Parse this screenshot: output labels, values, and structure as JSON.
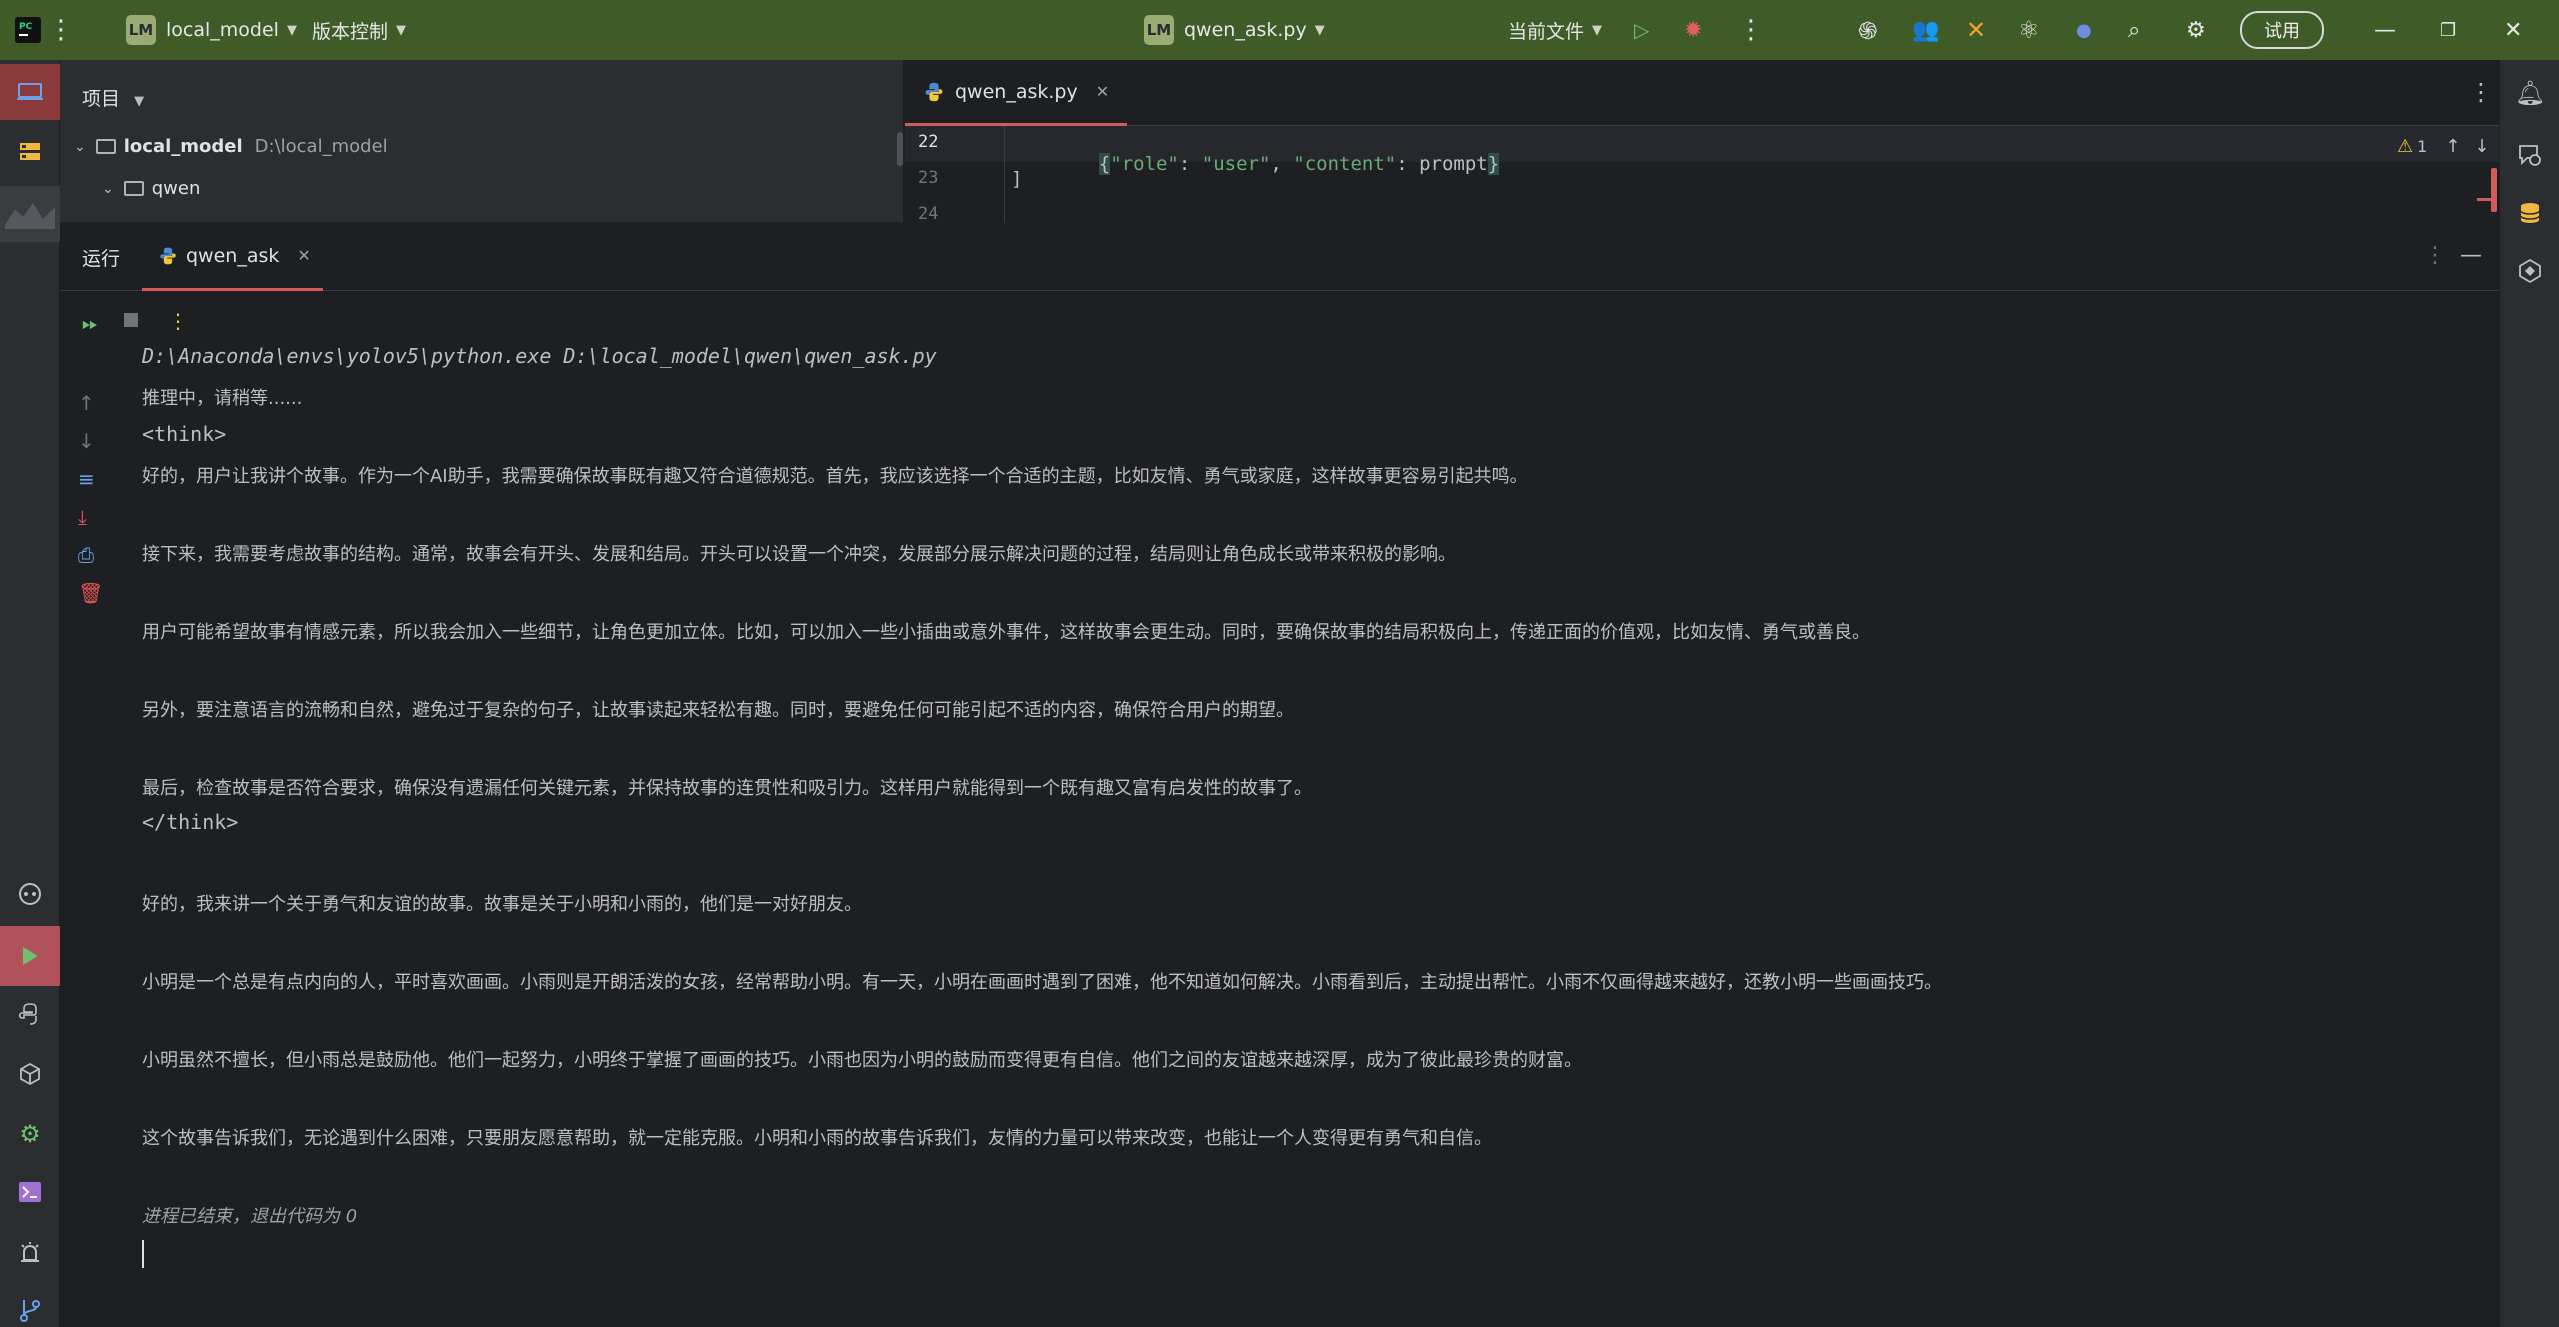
{
  "titlebar": {
    "project_badge": "LM",
    "project_name": "local_model",
    "vcs": "版本控制",
    "file_badge": "LM",
    "file_name": "qwen_ask.py",
    "run_config": "当前文件",
    "trial": "试用"
  },
  "project_panel": {
    "header": "项目",
    "root_name": "local_model",
    "root_path": "D:\\local_model",
    "child": "qwen"
  },
  "editor": {
    "tab_name": "qwen_ask.py",
    "warning_count": "1",
    "lines": [
      {
        "num": "22",
        "indent": "    ",
        "code": "{\"role\": \"user\", \"content\": prompt}"
      },
      {
        "num": "23",
        "indent": "",
        "code": "]"
      },
      {
        "num": "24",
        "indent": "",
        "code": ""
      }
    ]
  },
  "run_panel": {
    "label": "运行",
    "tab_name": "qwen_ask",
    "console": [
      {
        "text": "D:\\Anaconda\\envs\\yolov5\\python.exe D:\\local_model\\qwen\\qwen_ask.py",
        "style": "mono-italic"
      },
      {
        "text": "推理中，请稍等......",
        "style": "normal"
      },
      {
        "text": "<think>",
        "style": "mono"
      },
      {
        "text": "好的，用户让我讲个故事。作为一个AI助手，我需要确保故事既有趣又符合道德规范。首先，我应该选择一个合适的主题，比如友情、勇气或家庭，这样故事更容易引起共鸣。",
        "style": "normal"
      },
      {
        "text": "",
        "style": "normal"
      },
      {
        "text": "接下来，我需要考虑故事的结构。通常，故事会有开头、发展和结局。开头可以设置一个冲突，发展部分展示解决问题的过程，结局则让角色成长或带来积极的影响。",
        "style": "normal"
      },
      {
        "text": "",
        "style": "normal"
      },
      {
        "text": "用户可能希望故事有情感元素，所以我会加入一些细节，让角色更加立体。比如，可以加入一些小插曲或意外事件，这样故事会更生动。同时，要确保故事的结局积极向上，传递正面的价值观，比如友情、勇气或善良。",
        "style": "normal"
      },
      {
        "text": "",
        "style": "normal"
      },
      {
        "text": "另外，要注意语言的流畅和自然，避免过于复杂的句子，让故事读起来轻松有趣。同时，要避免任何可能引起不适的内容，确保符合用户的期望。",
        "style": "normal"
      },
      {
        "text": "",
        "style": "normal"
      },
      {
        "text": "最后，检查故事是否符合要求，确保没有遗漏任何关键元素，并保持故事的连贯性和吸引力。这样用户就能得到一个既有趣又富有启发性的故事了。",
        "style": "normal"
      },
      {
        "text": "</think>",
        "style": "mono"
      },
      {
        "text": "",
        "style": "normal"
      },
      {
        "text": "好的，我来讲一个关于勇气和友谊的故事。故事是关于小明和小雨的，他们是一对好朋友。",
        "style": "normal"
      },
      {
        "text": "",
        "style": "normal"
      },
      {
        "text": "小明是一个总是有点内向的人，平时喜欢画画。小雨则是开朗活泼的女孩，经常帮助小明。有一天，小明在画画时遇到了困难，他不知道如何解决。小雨看到后，主动提出帮忙。小雨不仅画得越来越好，还教小明一些画画技巧。",
        "style": "normal"
      },
      {
        "text": "",
        "style": "normal"
      },
      {
        "text": "小明虽然不擅长，但小雨总是鼓励他。他们一起努力，小明终于掌握了画画的技巧。小雨也因为小明的鼓励而变得更有自信。他们之间的友谊越来越深厚，成为了彼此最珍贵的财富。",
        "style": "normal"
      },
      {
        "text": "",
        "style": "normal"
      },
      {
        "text": "这个故事告诉我们，无论遇到什么困难，只要朋友愿意帮助，就一定能克服。小明和小雨的故事告诉我们，友情的力量可以带来改变，也能让一个人变得更有勇气和自信。",
        "style": "normal"
      },
      {
        "text": "",
        "style": "normal"
      },
      {
        "text": "进程已结束，退出代码为 0",
        "style": "italic"
      }
    ]
  },
  "colors": {
    "titlebar_bg": "#3f5b28",
    "panel_bg": "#2b2d30",
    "editor_bg": "#1e1f22",
    "accent_red": "#d35b5b",
    "string_green": "#6aab73"
  }
}
